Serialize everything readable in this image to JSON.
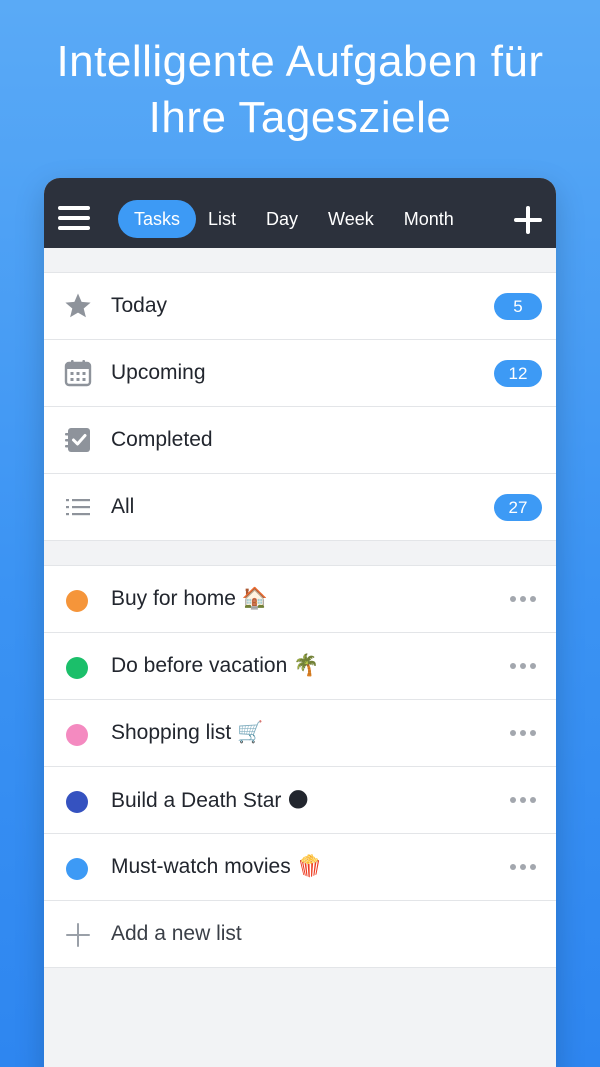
{
  "headline": {
    "line1": "Intelligente Aufgaben für",
    "line2": "Ihre Tagesziele"
  },
  "topbar": {
    "tabs": [
      {
        "label": "Tasks",
        "active": true
      },
      {
        "label": "List",
        "active": false
      },
      {
        "label": "Day",
        "active": false
      },
      {
        "label": "Week",
        "active": false
      },
      {
        "label": "Month",
        "active": false
      }
    ],
    "menu_icon": "hamburger-icon",
    "add_icon": "plus-icon"
  },
  "smart_lists": [
    {
      "label": "Today",
      "icon": "star-icon",
      "count": "5"
    },
    {
      "label": "Upcoming",
      "icon": "calendar-icon",
      "count": "12"
    },
    {
      "label": "Completed",
      "icon": "checklist-icon",
      "count": ""
    },
    {
      "label": "All",
      "icon": "list-icon",
      "count": "27"
    }
  ],
  "user_lists": [
    {
      "label": "Buy for home 🏠",
      "color": "#f5953a"
    },
    {
      "label": "Do before vacation 🌴",
      "color": "#1bbf6a"
    },
    {
      "label": "Shopping list 🛒",
      "color": "#f48ac0"
    },
    {
      "label": "Build a Death Star 🌑",
      "color": "#3552c0"
    },
    {
      "label": "Must-watch movies 🍿",
      "color": "#3d9af5"
    }
  ],
  "add_list_label": "Add a new list",
  "colors": {
    "accent": "#3d9af5",
    "topbar": "#2c313c"
  }
}
